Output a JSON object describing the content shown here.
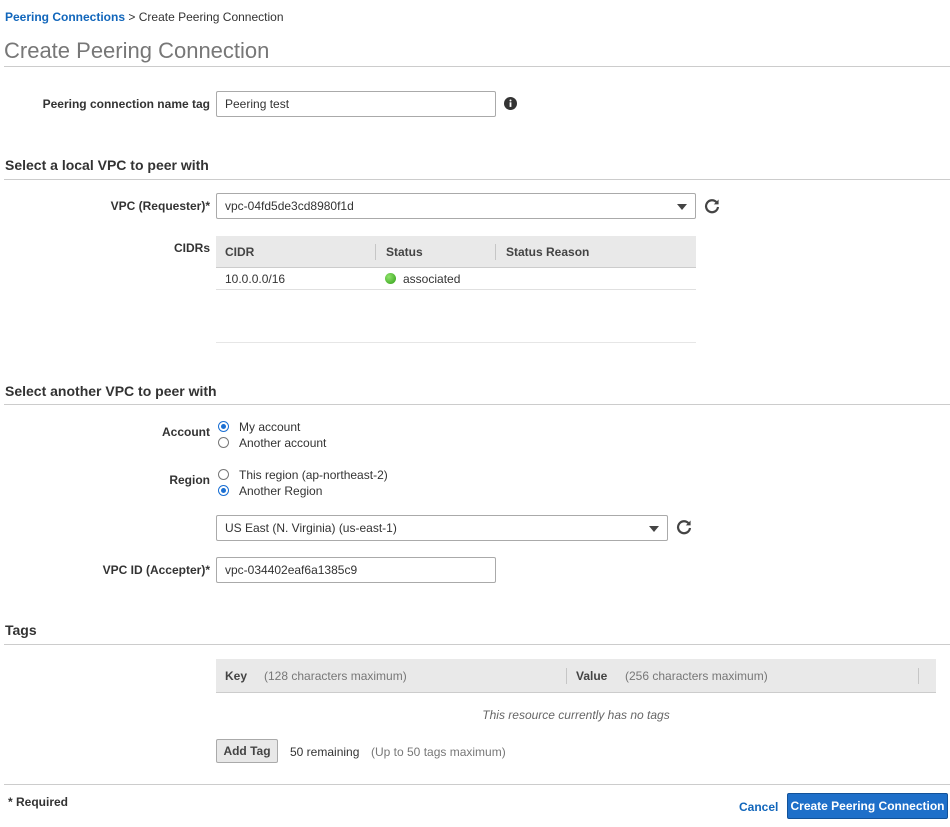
{
  "breadcrumb": {
    "parent": "Peering Connections",
    "separator": ">",
    "current": "Create Peering Connection"
  },
  "page_title": "Create Peering Connection",
  "name_tag": {
    "label": "Peering connection name tag",
    "value": "Peering test",
    "info_icon": "info-icon"
  },
  "local_section": {
    "title": "Select a local VPC to peer with",
    "vpc_label": "VPC (Requester)*",
    "vpc_value": "vpc-04fd5de3cd8980f1d",
    "cidrs_label": "CIDRs",
    "table": {
      "columns": [
        "CIDR",
        "Status",
        "Status Reason"
      ],
      "rows": [
        {
          "cidr": "10.0.0.0/16",
          "status": "associated",
          "status_color": "#3aa61f",
          "reason": ""
        }
      ]
    }
  },
  "another_section": {
    "title": "Select another VPC to peer with",
    "account_label": "Account",
    "account_options": [
      "My account",
      "Another account"
    ],
    "account_selected": "My account",
    "region_label": "Region",
    "region_options": [
      "This region (ap-northeast-2)",
      "Another Region"
    ],
    "region_selected": "Another Region",
    "region_select_value": "US East (N. Virginia) (us-east-1)",
    "vpc_id_label": "VPC ID (Accepter)*",
    "vpc_id_value": "vpc-034402eaf6a1385c9"
  },
  "tags_section": {
    "title": "Tags",
    "key_header": "Key",
    "key_hint": "(128 characters maximum)",
    "value_header": "Value",
    "value_hint": "(256 characters maximum)",
    "empty_message": "This resource currently has no tags",
    "add_tag_label": "Add Tag",
    "remaining": "50 remaining",
    "limit_hint": "(Up to 50 tags maximum)"
  },
  "footer": {
    "required_note": "* Required",
    "cancel_label": "Cancel",
    "create_label": "Create Peering Connection"
  },
  "colors": {
    "accent": "#1e6fc9",
    "link": "#1166bb",
    "title_gray": "#777777"
  }
}
